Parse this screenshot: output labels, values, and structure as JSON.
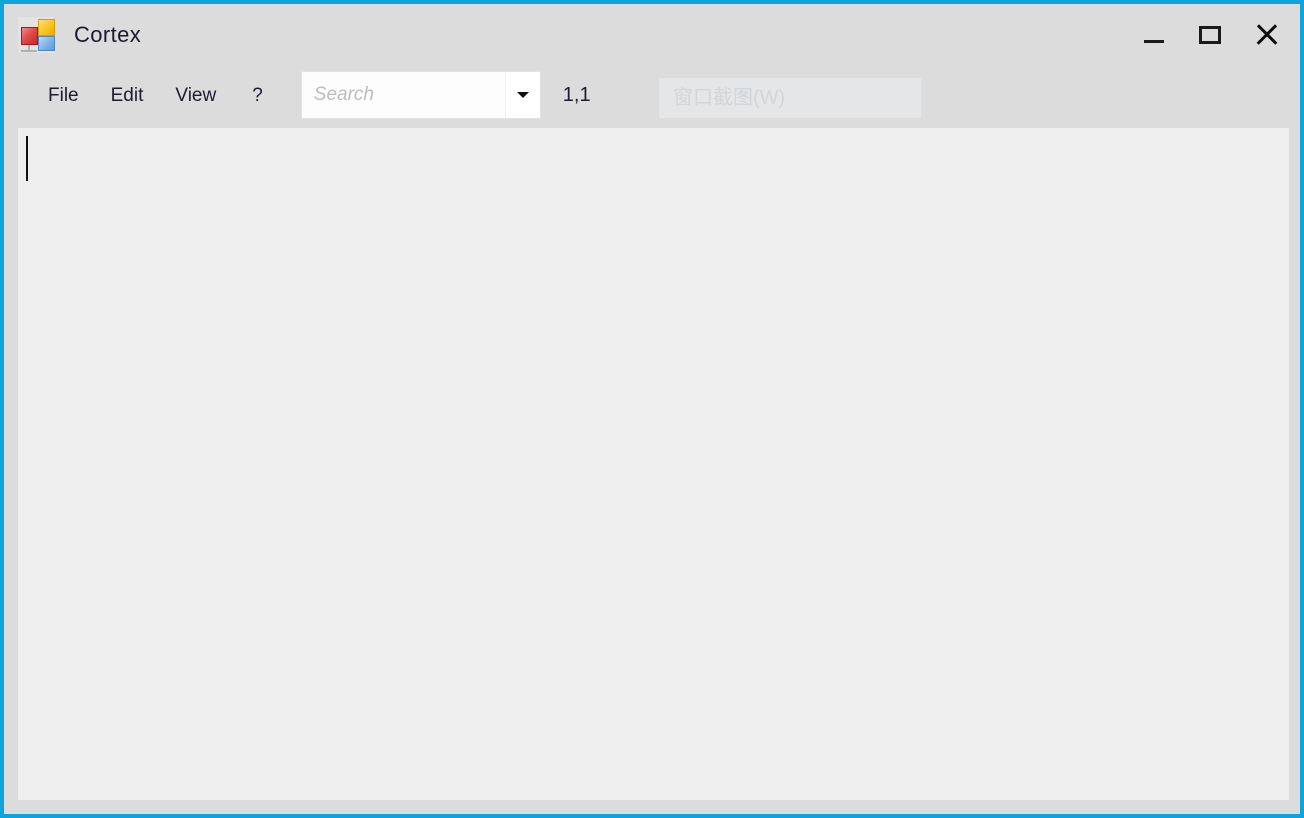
{
  "window": {
    "title": "Cortex",
    "icon_name": "cortex-app-icon",
    "border_color": "#0fa3dd",
    "chrome_bg": "#dcdcdc",
    "editor_bg": "#efefef",
    "controls": {
      "minimize_label": "Minimize",
      "maximize_label": "Maximize",
      "close_label": "Close"
    }
  },
  "menu": {
    "items": [
      {
        "label": "File",
        "name": "file"
      },
      {
        "label": "Edit",
        "name": "edit"
      },
      {
        "label": "View",
        "name": "view"
      },
      {
        "label": "?",
        "name": "help"
      }
    ]
  },
  "search": {
    "value": "",
    "placeholder": "Search",
    "dropdown_icon": "chevron-down-icon"
  },
  "status": {
    "cursor_position": "1,1"
  },
  "ghost_menu": {
    "label": "窗口截图(W)",
    "text_color": "#d3d6d8",
    "panel_color": "#e4e6e8"
  },
  "editor": {
    "content": "",
    "caret_visible": true
  }
}
